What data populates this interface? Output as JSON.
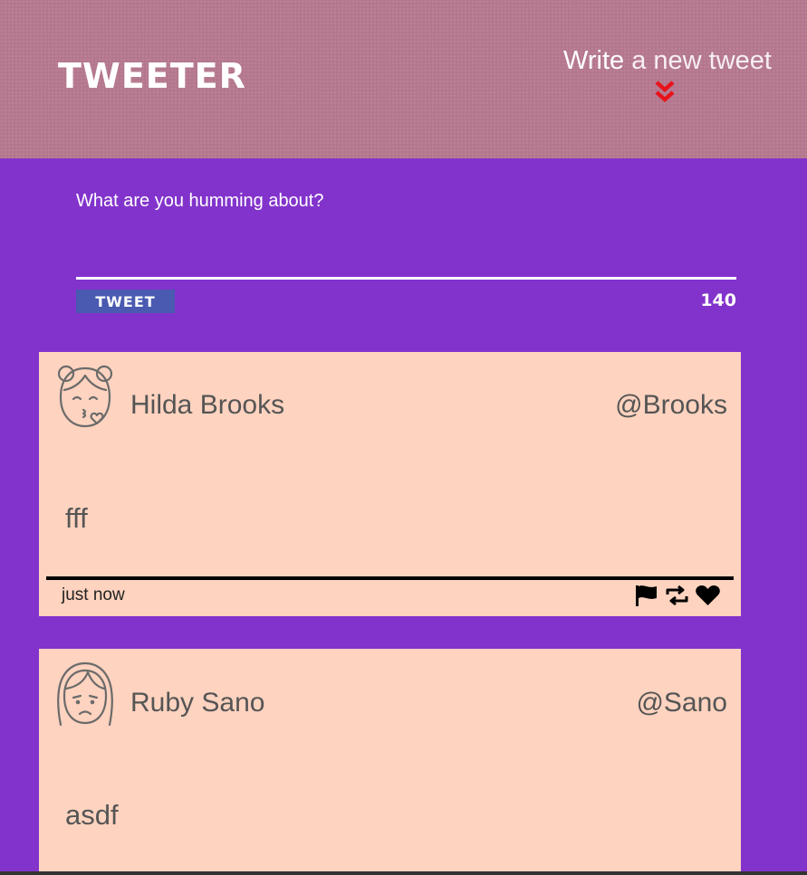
{
  "header": {
    "logo": "TWEETER",
    "compose_bold": "Write",
    "compose_rest": " a new tweet"
  },
  "composer": {
    "placeholder": "What are you humming about?",
    "submit_label": "TWEET",
    "counter": "140"
  },
  "tweets": [
    {
      "name": "Hilda Brooks",
      "handle": "@Brooks",
      "content": "fff",
      "time": "just now",
      "avatar": "girl-kiss-avatar"
    },
    {
      "name": "Ruby Sano",
      "handle": "@Sano",
      "content": "asdf",
      "avatar": "girl-sad-avatar"
    }
  ],
  "icons": [
    "flag-icon",
    "retweet-icon",
    "heart-icon",
    "double-chevron-down-icon"
  ],
  "colors": {
    "header_bg": "#b4778e",
    "page_bg": "#8233cc",
    "tweet_bg": "#fed3bf",
    "button_bg": "#4a5ab1",
    "chevron": "#e8131b"
  }
}
